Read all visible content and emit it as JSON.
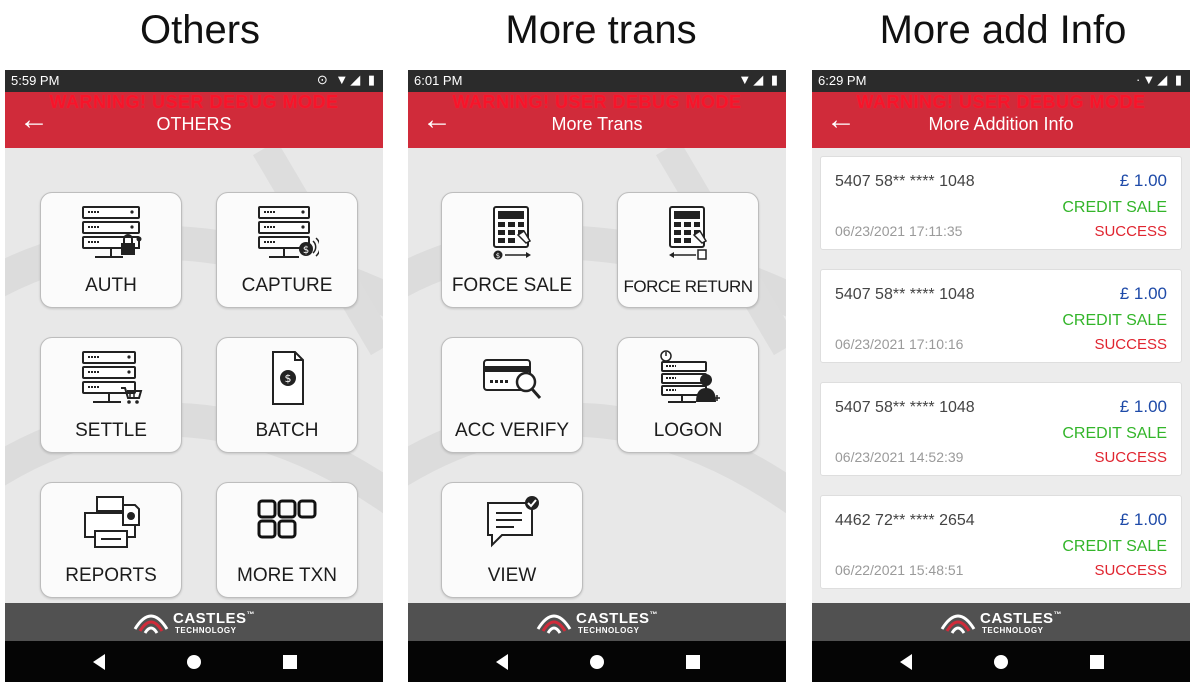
{
  "captions": [
    "Others",
    "More trans",
    "More add Info"
  ],
  "common": {
    "warning": "WARNING! USER DEBUG MODE",
    "back_icon": "back-arrow-icon",
    "logo_brand": "CASTLES",
    "logo_tm": "™",
    "logo_sub": "TECHNOLOGY"
  },
  "colors": {
    "app_bar": "#d02b3a",
    "warning_text": "#f7142a",
    "amount": "#1e4aa8",
    "credit_sale": "#33b52a",
    "success": "#e0242f"
  },
  "screens": [
    {
      "time": "5:59 PM",
      "status_icons": "⊙ ▼◢ ▮",
      "title": "OTHERS",
      "tiles": [
        {
          "label": "AUTH",
          "icon": "server-lock-icon"
        },
        {
          "label": "CAPTURE",
          "icon": "server-payment-icon"
        },
        {
          "label": "SETTLE",
          "icon": "server-cart-icon"
        },
        {
          "label": "BATCH",
          "icon": "document-dollar-icon"
        },
        {
          "label": "REPORTS",
          "icon": "printer-icon"
        },
        {
          "label": "MORE TXN",
          "icon": "grid-icon"
        }
      ]
    },
    {
      "time": "6:01 PM",
      "status_icons": "▼◢ ▮",
      "title": "More Trans",
      "tiles": [
        {
          "label": "FORCE SALE",
          "icon": "keypad-sale-icon"
        },
        {
          "label": "FORCE RETURN",
          "icon": "keypad-return-icon"
        },
        {
          "label": "ACC VERIFY",
          "icon": "card-search-icon"
        },
        {
          "label": "LOGON",
          "icon": "server-user-icon"
        },
        {
          "label": "VIEW",
          "icon": "message-check-icon"
        }
      ]
    },
    {
      "time": "6:29 PM",
      "status_icons": "·▼◢ ▮",
      "title": "More Addition Info",
      "transactions": [
        {
          "pan": "5407 58** **** 1048",
          "amount": "£ 1.00",
          "type": "CREDIT SALE",
          "date": "06/23/2021 17:11:35",
          "status": "SUCCESS"
        },
        {
          "pan": "5407 58** **** 1048",
          "amount": "£ 1.00",
          "type": "CREDIT SALE",
          "date": "06/23/2021 17:10:16",
          "status": "SUCCESS"
        },
        {
          "pan": "5407 58** **** 1048",
          "amount": "£ 1.00",
          "type": "CREDIT SALE",
          "date": "06/23/2021 14:52:39",
          "status": "SUCCESS"
        },
        {
          "pan": "4462 72** **** 2654",
          "amount": "£ 1.00",
          "type": "CREDIT SALE",
          "date": "06/22/2021 15:48:51",
          "status": "SUCCESS"
        }
      ]
    }
  ]
}
